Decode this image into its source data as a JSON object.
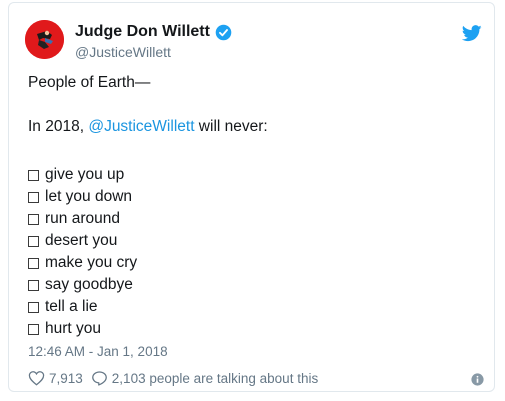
{
  "tweet": {
    "author_name": "Judge Don Willett",
    "author_handle": "@JusticeWillett",
    "greeting": "People of Earth—",
    "intro_prefix": "In 2018, ",
    "intro_mention": "@JusticeWillett",
    "intro_suffix": " will never:",
    "items": [
      "give you up",
      "let you down",
      "run around",
      "desert you",
      "make you cry",
      "say goodbye",
      "tell a lie",
      "hurt you"
    ],
    "timestamp": "12:46 AM - Jan 1, 2018",
    "likes": "7,913",
    "replies_text": "2,103 people are talking about this"
  },
  "icons": {
    "avatar": "avatar-image",
    "verified": "verified-badge-icon",
    "brand": "twitter-bird-icon",
    "like": "heart-icon",
    "reply": "speech-bubble-icon",
    "info": "info-icon"
  },
  "colors": {
    "link": "#1b95e0",
    "muted": "#657786",
    "avatar_bg": "#e0191b",
    "border": "#e1e8ed"
  }
}
